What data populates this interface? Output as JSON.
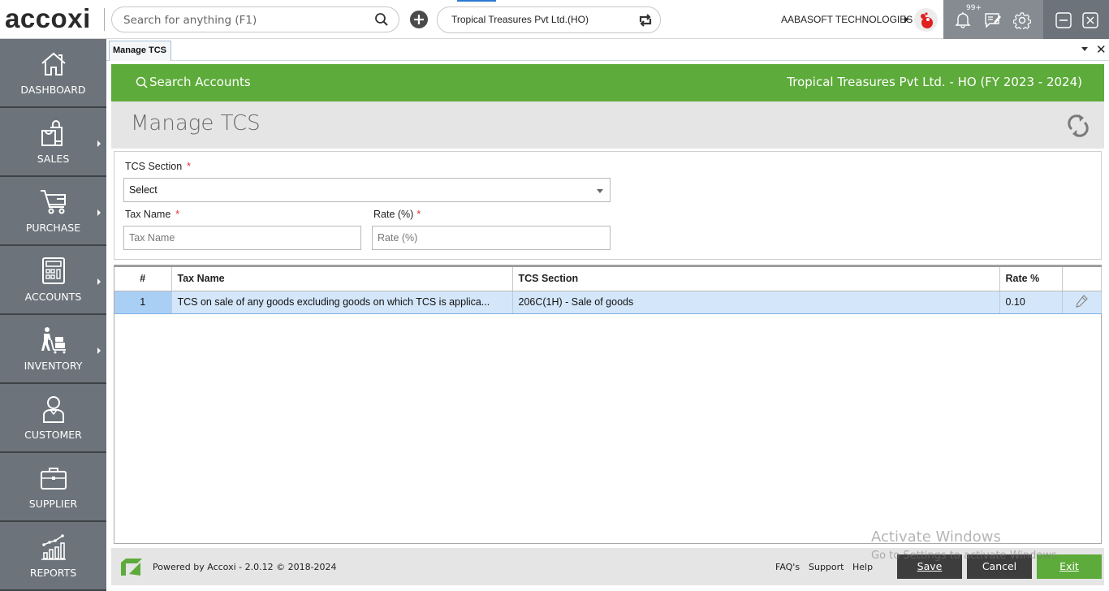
{
  "app": {
    "logo_text": "accoxi",
    "search_placeholder": "Search for anything (F1)",
    "company_selector": "Tropical Treasures Pvt Ltd.(HO)",
    "organization": "AABASOFT TECHNOLOGIES",
    "notification_badge": "99+",
    "icons": [
      "search-icon",
      "add-icon",
      "switch-company-icon",
      "avatar",
      "bell-icon",
      "chat-edit-icon",
      "gear-icon",
      "minimize-icon",
      "close-icon"
    ]
  },
  "sidebar": {
    "items": [
      {
        "label": "DASHBOARD",
        "icon": "home-icon",
        "has_submenu": false
      },
      {
        "label": "SALES",
        "icon": "shopping-bags-icon",
        "has_submenu": true
      },
      {
        "label": "PURCHASE",
        "icon": "cart-icon",
        "has_submenu": true
      },
      {
        "label": "ACCOUNTS",
        "icon": "calculator-icon",
        "has_submenu": true
      },
      {
        "label": "INVENTORY",
        "icon": "trolley-worker-icon",
        "has_submenu": true
      },
      {
        "label": "CUSTOMER",
        "icon": "user-icon",
        "has_submenu": false
      },
      {
        "label": "SUPPLIER",
        "icon": "briefcase-icon",
        "has_submenu": false
      },
      {
        "label": "REPORTS",
        "icon": "chart-icon",
        "has_submenu": false
      }
    ]
  },
  "tabs": [
    {
      "label": "Manage TCS",
      "active": true
    }
  ],
  "header": {
    "search_accounts": "Search Accounts",
    "company_fy": "Tropical Treasures Pvt Ltd. - HO (FY 2023 - 2024)",
    "page_title": "Manage TCS"
  },
  "form": {
    "tcs_section_label": "TCS Section",
    "tcs_section_value": "Select",
    "tax_name_label": "Tax Name",
    "tax_name_placeholder": "Tax Name",
    "rate_label": "Rate (%)",
    "rate_placeholder": "Rate (%)",
    "required_marker": "*"
  },
  "table": {
    "columns": [
      "#",
      "Tax Name",
      "TCS Section",
      "Rate %",
      ""
    ],
    "rows": [
      {
        "index": "1",
        "tax_name": "TCS on sale of any goods excluding goods on which TCS is applica...",
        "tcs_section": "206C(1H) - Sale of goods",
        "rate": "0.10",
        "selected": true
      }
    ]
  },
  "footer": {
    "powered_by": "Powered by Accoxi - 2.0.12 © 2018-2024",
    "links": [
      "FAQ's",
      "Support",
      "Help"
    ],
    "buttons": {
      "save": "Save",
      "cancel": "Cancel",
      "exit": "Exit"
    }
  },
  "watermark": {
    "line1": "Activate Windows",
    "line2": "Go to Settings to activate Windows."
  },
  "colors": {
    "brand_green": "#5dab3a",
    "sidebar_bg": "#6c737a",
    "selected_row": "#d4e6fa",
    "dark_button": "#3d3d3d"
  }
}
